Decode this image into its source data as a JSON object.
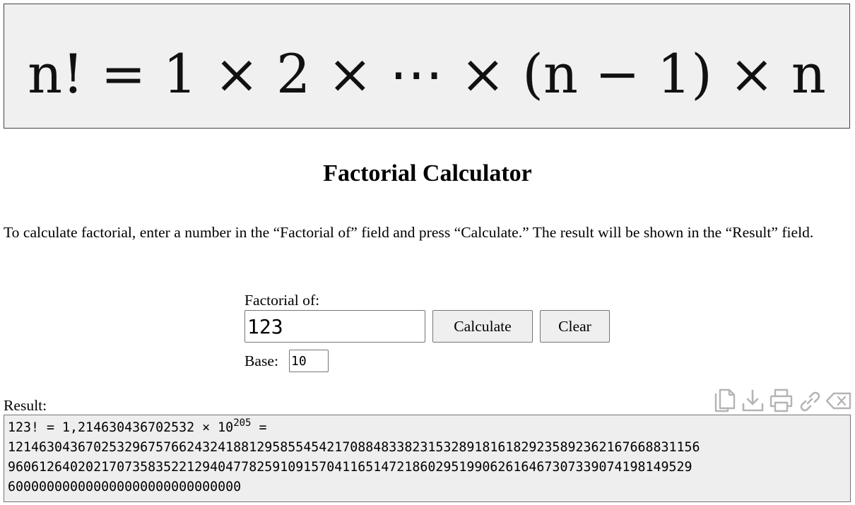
{
  "formula": {
    "text": "n! = 1 × 2 × ⋯ × (n − 1) × n"
  },
  "page_title": "Factorial Calculator",
  "intro_text": "To calculate factorial, enter a number in the “Factorial of” field and press “Calculate.” The result will be shown in the “Result” field.",
  "form": {
    "factorial_label": "Factorial of:",
    "factorial_value": "123",
    "calculate_label": "Calculate",
    "clear_label": "Clear",
    "base_label": "Base:",
    "base_value": "10"
  },
  "result": {
    "label": "Result:",
    "sci_prefix": "123! = 1,214630436702532 × 10",
    "sci_exponent": "205",
    "sci_suffix": " =",
    "lines": [
      "12146304367025329675766243241881295855454217088483382315328918161829235892362167668831156",
      "9606126402021707358352212940477825910915704116514721860295199062616467307339074198149529",
      "600000000000000000000000000000"
    ]
  },
  "toolbar": {
    "icons": [
      "copy-icon",
      "download-icon",
      "print-icon",
      "link-icon",
      "clear-result-icon"
    ]
  },
  "colors": {
    "formula_background": "#f0f0f0",
    "result_background": "#eeeeee",
    "button_background": "#efefef",
    "icon_color": "#b4b4b4"
  }
}
